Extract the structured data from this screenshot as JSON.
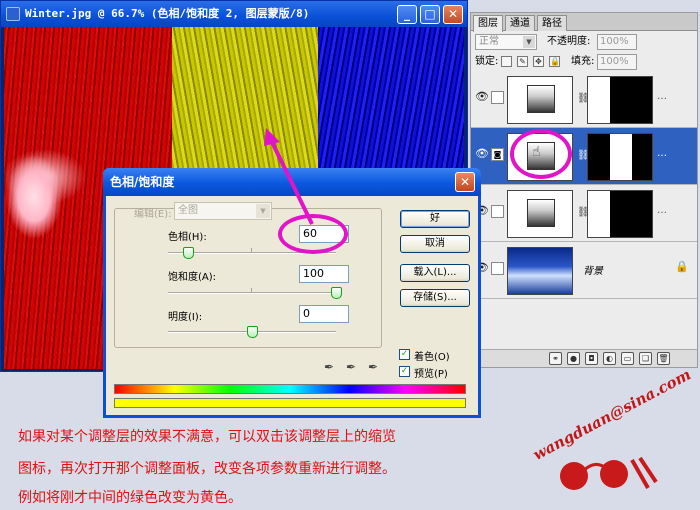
{
  "document_window": {
    "title": "Winter.jpg @ 66.7% (色相/饱和度 2, 图层蒙版/8)",
    "minimize": "_",
    "maximize": "□",
    "close": "✕"
  },
  "layers_panel": {
    "tabs": [
      "图层",
      "通道",
      "路径"
    ],
    "blend_mode": "正常",
    "opacity_label": "不透明度:",
    "opacity_value": "100%",
    "lock_label": "锁定:",
    "fill_label": "填充:",
    "fill_value": "100%",
    "background_layer_name": "背景",
    "icons": [
      "eye-icon",
      "chain-icon",
      "lock-icon",
      "link-layers-icon",
      "fx-icon",
      "mask-icon",
      "adjustment-icon",
      "folder-icon",
      "new-layer-icon",
      "trash-icon"
    ]
  },
  "dialog": {
    "title": "色相/饱和度",
    "edit_label": "编辑(E):",
    "edit_value": "全图",
    "hue_label": "色相(H):",
    "hue_value": "60",
    "saturation_label": "饱和度(A):",
    "saturation_value": "100",
    "lightness_label": "明度(I):",
    "lightness_value": "0",
    "hue_slider_fraction": 0.12,
    "saturation_slider_fraction": 1.0,
    "lightness_slider_fraction": 0.5,
    "ok_label": "好",
    "cancel_label": "取消",
    "load_label": "载入(L)...",
    "save_label": "存储(S)...",
    "colorize_label": "着色(O)",
    "colorize_checked": true,
    "preview_label": "预览(P)",
    "preview_checked": true,
    "close": "✕"
  },
  "caption": {
    "line1": "如果对某个调整层的效果不满意，可以双击该调整层上的缩览",
    "line2": "图标，再次打开那个调整面板，改变各项参数重新进行调整。",
    "line3": "例如将刚才中间的绿色改变为黄色。"
  },
  "watermark": {
    "text": "wangduan@sina.com"
  },
  "colors": {
    "accent_ring": "#e014c8",
    "caption": "#e01010",
    "selected_layer": "#2f62c0"
  }
}
